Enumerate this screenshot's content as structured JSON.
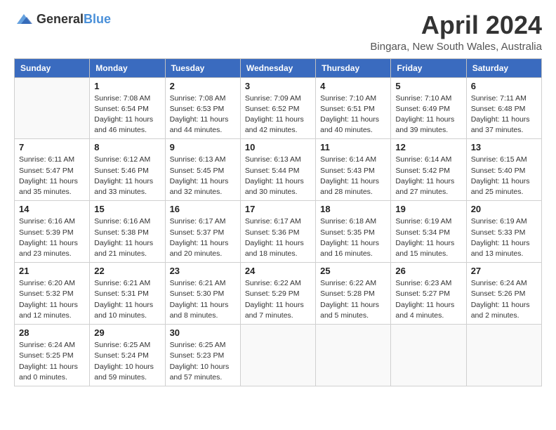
{
  "header": {
    "logo_general": "General",
    "logo_blue": "Blue",
    "title": "April 2024",
    "location": "Bingara, New South Wales, Australia"
  },
  "weekdays": [
    "Sunday",
    "Monday",
    "Tuesday",
    "Wednesday",
    "Thursday",
    "Friday",
    "Saturday"
  ],
  "weeks": [
    [
      {
        "day": null
      },
      {
        "day": 1,
        "sunrise": "7:08 AM",
        "sunset": "6:54 PM",
        "daylight": "11 hours and 46 minutes."
      },
      {
        "day": 2,
        "sunrise": "7:08 AM",
        "sunset": "6:53 PM",
        "daylight": "11 hours and 44 minutes."
      },
      {
        "day": 3,
        "sunrise": "7:09 AM",
        "sunset": "6:52 PM",
        "daylight": "11 hours and 42 minutes."
      },
      {
        "day": 4,
        "sunrise": "7:10 AM",
        "sunset": "6:51 PM",
        "daylight": "11 hours and 40 minutes."
      },
      {
        "day": 5,
        "sunrise": "7:10 AM",
        "sunset": "6:49 PM",
        "daylight": "11 hours and 39 minutes."
      },
      {
        "day": 6,
        "sunrise": "7:11 AM",
        "sunset": "6:48 PM",
        "daylight": "11 hours and 37 minutes."
      }
    ],
    [
      {
        "day": 7,
        "sunrise": "6:11 AM",
        "sunset": "5:47 PM",
        "daylight": "11 hours and 35 minutes."
      },
      {
        "day": 8,
        "sunrise": "6:12 AM",
        "sunset": "5:46 PM",
        "daylight": "11 hours and 33 minutes."
      },
      {
        "day": 9,
        "sunrise": "6:13 AM",
        "sunset": "5:45 PM",
        "daylight": "11 hours and 32 minutes."
      },
      {
        "day": 10,
        "sunrise": "6:13 AM",
        "sunset": "5:44 PM",
        "daylight": "11 hours and 30 minutes."
      },
      {
        "day": 11,
        "sunrise": "6:14 AM",
        "sunset": "5:43 PM",
        "daylight": "11 hours and 28 minutes."
      },
      {
        "day": 12,
        "sunrise": "6:14 AM",
        "sunset": "5:42 PM",
        "daylight": "11 hours and 27 minutes."
      },
      {
        "day": 13,
        "sunrise": "6:15 AM",
        "sunset": "5:40 PM",
        "daylight": "11 hours and 25 minutes."
      }
    ],
    [
      {
        "day": 14,
        "sunrise": "6:16 AM",
        "sunset": "5:39 PM",
        "daylight": "11 hours and 23 minutes."
      },
      {
        "day": 15,
        "sunrise": "6:16 AM",
        "sunset": "5:38 PM",
        "daylight": "11 hours and 21 minutes."
      },
      {
        "day": 16,
        "sunrise": "6:17 AM",
        "sunset": "5:37 PM",
        "daylight": "11 hours and 20 minutes."
      },
      {
        "day": 17,
        "sunrise": "6:17 AM",
        "sunset": "5:36 PM",
        "daylight": "11 hours and 18 minutes."
      },
      {
        "day": 18,
        "sunrise": "6:18 AM",
        "sunset": "5:35 PM",
        "daylight": "11 hours and 16 minutes."
      },
      {
        "day": 19,
        "sunrise": "6:19 AM",
        "sunset": "5:34 PM",
        "daylight": "11 hours and 15 minutes."
      },
      {
        "day": 20,
        "sunrise": "6:19 AM",
        "sunset": "5:33 PM",
        "daylight": "11 hours and 13 minutes."
      }
    ],
    [
      {
        "day": 21,
        "sunrise": "6:20 AM",
        "sunset": "5:32 PM",
        "daylight": "11 hours and 12 minutes."
      },
      {
        "day": 22,
        "sunrise": "6:21 AM",
        "sunset": "5:31 PM",
        "daylight": "11 hours and 10 minutes."
      },
      {
        "day": 23,
        "sunrise": "6:21 AM",
        "sunset": "5:30 PM",
        "daylight": "11 hours and 8 minutes."
      },
      {
        "day": 24,
        "sunrise": "6:22 AM",
        "sunset": "5:29 PM",
        "daylight": "11 hours and 7 minutes."
      },
      {
        "day": 25,
        "sunrise": "6:22 AM",
        "sunset": "5:28 PM",
        "daylight": "11 hours and 5 minutes."
      },
      {
        "day": 26,
        "sunrise": "6:23 AM",
        "sunset": "5:27 PM",
        "daylight": "11 hours and 4 minutes."
      },
      {
        "day": 27,
        "sunrise": "6:24 AM",
        "sunset": "5:26 PM",
        "daylight": "11 hours and 2 minutes."
      }
    ],
    [
      {
        "day": 28,
        "sunrise": "6:24 AM",
        "sunset": "5:25 PM",
        "daylight": "11 hours and 0 minutes."
      },
      {
        "day": 29,
        "sunrise": "6:25 AM",
        "sunset": "5:24 PM",
        "daylight": "10 hours and 59 minutes."
      },
      {
        "day": 30,
        "sunrise": "6:25 AM",
        "sunset": "5:23 PM",
        "daylight": "10 hours and 57 minutes."
      },
      {
        "day": null
      },
      {
        "day": null
      },
      {
        "day": null
      },
      {
        "day": null
      }
    ]
  ],
  "labels": {
    "sunrise": "Sunrise:",
    "sunset": "Sunset:",
    "daylight": "Daylight:"
  }
}
